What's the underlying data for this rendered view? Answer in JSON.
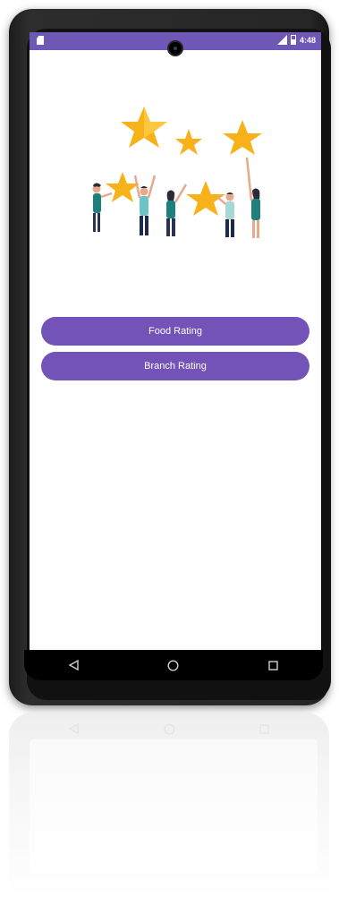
{
  "status_bar": {
    "time": "4:48",
    "network": "LTE",
    "color": "#6e57b5"
  },
  "illustration": {
    "icon": "people-holding-stars-illustration"
  },
  "buttons": {
    "food_rating": "Food Rating",
    "branch_rating": "Branch Rating",
    "color": "#7353b7"
  },
  "navigation": {
    "items": [
      "back-icon",
      "home-icon",
      "recents-icon"
    ]
  }
}
